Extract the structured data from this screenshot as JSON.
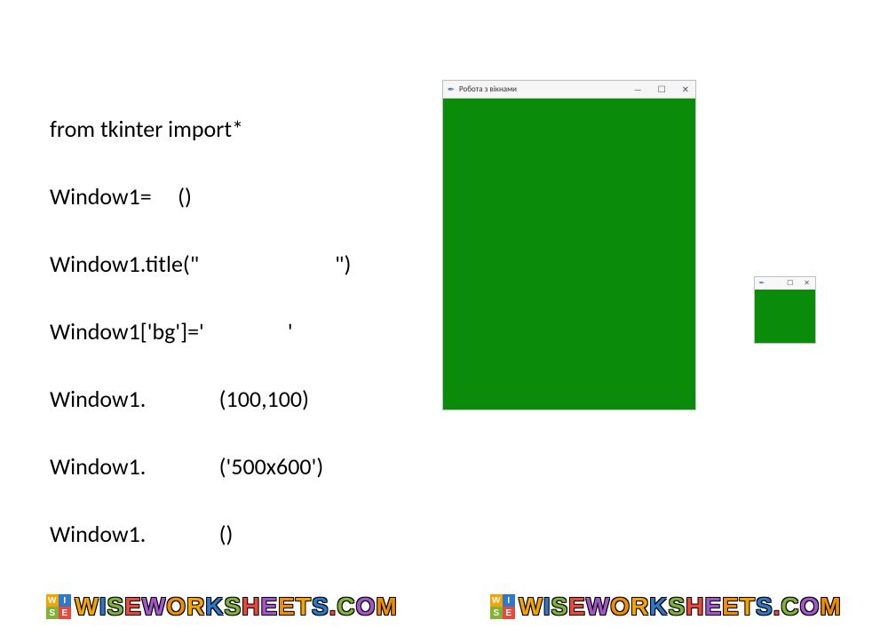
{
  "code": {
    "line1": "from tkinter import*",
    "line2": "Window1=     ()",
    "line3": "Window1.title(\"                          \")",
    "line4": "Window1['bg']='                '",
    "line5": "Window1.              (100,100)",
    "line6": "Window1.              ('500x600')",
    "line7": "Window1.              ()"
  },
  "window_large": {
    "title": "Робота з вікнами",
    "minimize": "—",
    "maximize": "☐",
    "close": "✕",
    "bg_color": "#0a8c0a"
  },
  "window_small": {
    "minimize": "–",
    "maximize": "☐",
    "close": "✕",
    "bg_color": "#0a8c0a"
  },
  "watermark": {
    "badge": [
      "W",
      "I",
      "S",
      "E"
    ],
    "text": "WISEWORKSHEETS.COM"
  }
}
